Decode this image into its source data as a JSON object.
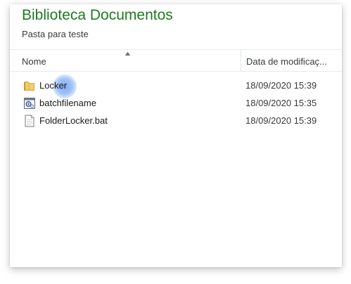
{
  "window": {
    "title": "Biblioteca Documentos",
    "subtitle": "Pasta para teste"
  },
  "columns": {
    "name": "Nome",
    "date": "Data de modificaç..."
  },
  "files": [
    {
      "name": "Locker",
      "date": "18/09/2020 15:39",
      "icon": "folder-icon"
    },
    {
      "name": "batchfilename",
      "date": "18/09/2020 15:35",
      "icon": "batch-file-icon"
    },
    {
      "name": "FolderLocker.bat",
      "date": "18/09/2020 15:39",
      "icon": "text-file-icon"
    }
  ],
  "colors": {
    "title": "#1e7a1e",
    "cursor_highlight": "#78a5f0"
  }
}
